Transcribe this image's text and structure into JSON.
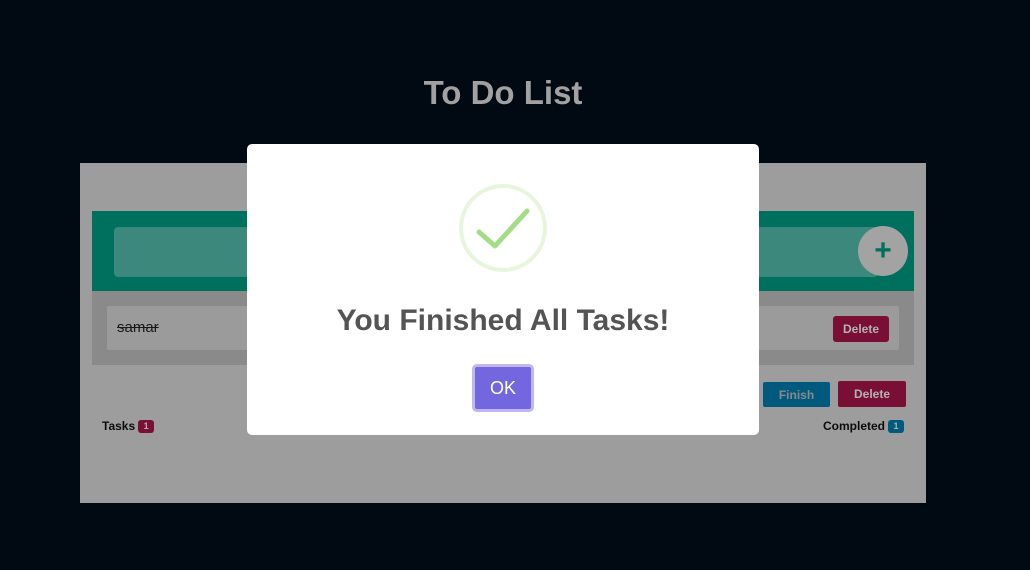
{
  "app": {
    "title": "To Do List"
  },
  "input_bar": {
    "value": "",
    "add_label": "+"
  },
  "tasks": [
    {
      "name": "samar",
      "completed": true,
      "delete_label": "Delete"
    }
  ],
  "actions": {
    "finish_label": "Finish",
    "delete_label": "Delete"
  },
  "stats": {
    "tasks_label": "Tasks",
    "tasks_count": "1",
    "completed_label": "Completed",
    "completed_count": "1"
  },
  "modal": {
    "icon": "success-check-icon",
    "title": "You Finished All Tasks!",
    "ok_label": "OK"
  },
  "colors": {
    "background": "#010913",
    "accent_teal": "#00705e",
    "danger": "#7a0f35",
    "info": "#005a7e",
    "modal_button": "#7367e0",
    "success": "#a5dc86"
  }
}
